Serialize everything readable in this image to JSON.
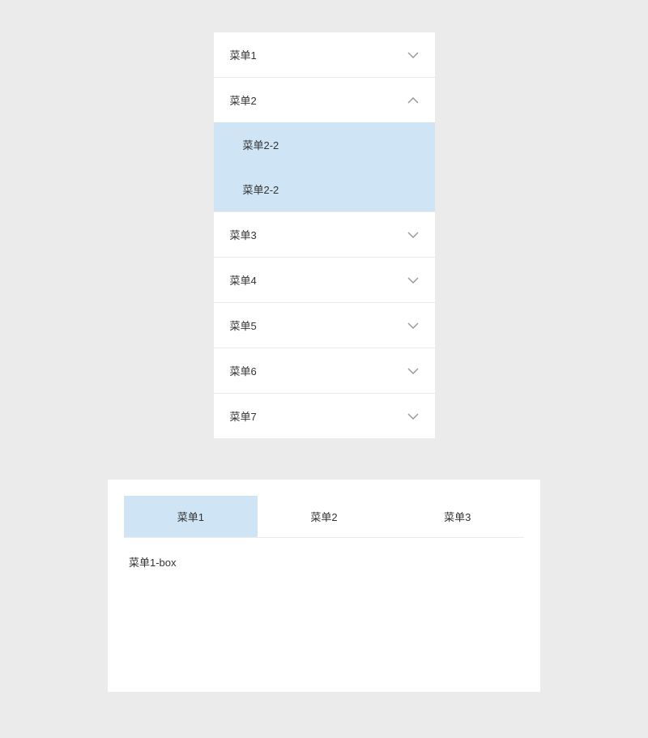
{
  "accordion": {
    "items": [
      {
        "label": "菜单1",
        "expanded": false,
        "children": []
      },
      {
        "label": "菜单2",
        "expanded": true,
        "children": [
          {
            "label": "菜单2-2"
          },
          {
            "label": "菜单2-2"
          }
        ]
      },
      {
        "label": "菜单3",
        "expanded": false,
        "children": []
      },
      {
        "label": "菜单4",
        "expanded": false,
        "children": []
      },
      {
        "label": "菜单5",
        "expanded": false,
        "children": []
      },
      {
        "label": "菜单6",
        "expanded": false,
        "children": []
      },
      {
        "label": "菜单7",
        "expanded": false,
        "children": []
      }
    ]
  },
  "tabs": {
    "items": [
      {
        "label": "菜单1",
        "active": true
      },
      {
        "label": "菜单2",
        "active": false
      },
      {
        "label": "菜单3",
        "active": false
      }
    ],
    "content": "菜单1-box"
  }
}
